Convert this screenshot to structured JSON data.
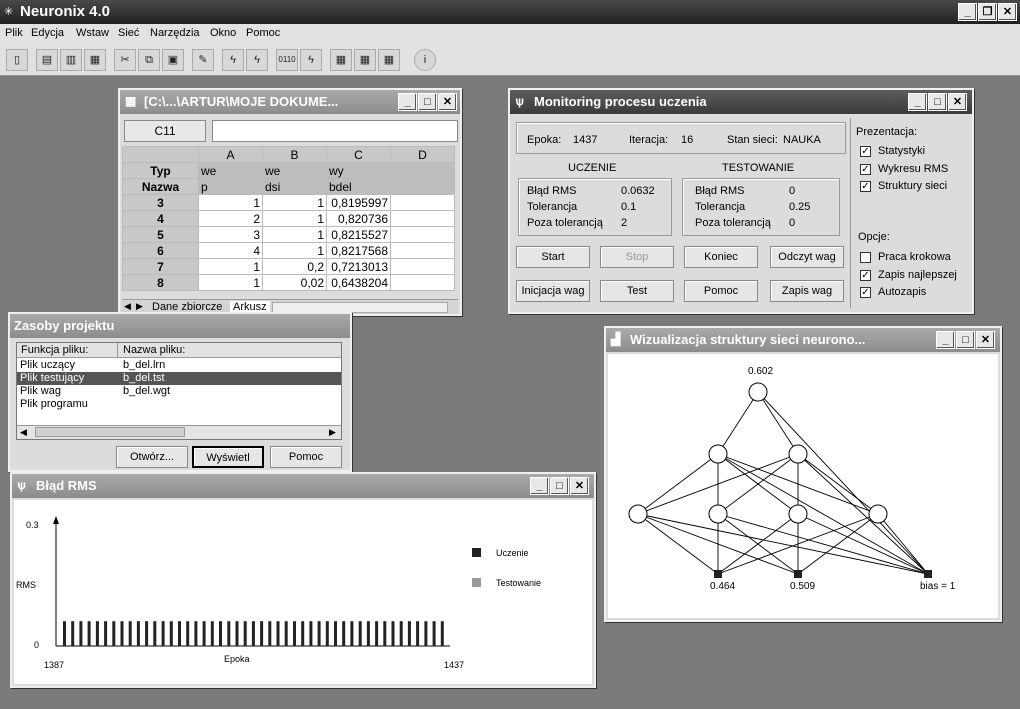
{
  "app": {
    "title": "Neuronix 4.0"
  },
  "menu": [
    "Plik",
    "Edycja",
    "Wstaw",
    "Sieć",
    "Narzędzia",
    "Okno",
    "Pomoc"
  ],
  "toolbar": {
    "icons": [
      "exit-icon",
      "new-icon",
      "open-icon",
      "save-icon",
      "cut-icon",
      "copy-icon",
      "paste-icon",
      "edit-icon",
      "learn-icon",
      "test-icon",
      "binary-icon",
      "run-icon",
      "table-icon",
      "table-export-icon",
      "table-view-icon",
      "info-icon"
    ],
    "binary_text": "0110"
  },
  "sheet": {
    "title": "[C:\\...\\ARTUR\\MOJE DOKUME...",
    "cell_ref": "C11",
    "columns": [
      "A",
      "B",
      "C",
      "D"
    ],
    "typ_label": "Typ",
    "nazwa_label": "Nazwa",
    "typ": [
      "we",
      "we",
      "wy",
      ""
    ],
    "nazwa": [
      "p",
      "dsi",
      "bdel",
      ""
    ],
    "rows": [
      {
        "n": "3",
        "a": "1",
        "b": "1",
        "c": "0,8195997"
      },
      {
        "n": "4",
        "a": "2",
        "b": "1",
        "c": "0,820736"
      },
      {
        "n": "5",
        "a": "3",
        "b": "1",
        "c": "0,8215527"
      },
      {
        "n": "6",
        "a": "4",
        "b": "1",
        "c": "0,8217568"
      },
      {
        "n": "7",
        "a": "1",
        "b": "0,2",
        "c": "0,7213013"
      },
      {
        "n": "8",
        "a": "1",
        "b": "0,02",
        "c": "0,6438204"
      }
    ],
    "tabs": [
      "Dane zbiorcze",
      "Arkusz"
    ]
  },
  "monitor": {
    "title": "Monitoring procesu uczenia",
    "epoka_label": "Epoka:",
    "epoka": "1437",
    "iteracja_label": "Iteracja:",
    "iteracja": "16",
    "stan_label": "Stan sieci:",
    "stan": "NAUKA",
    "uczenie": "UCZENIE",
    "testowanie": "TESTOWANIE",
    "rms_label": "Błąd RMS",
    "tol_label": "Tolerancja",
    "poza_label": "Poza tolerancją",
    "u_rms": "0.0632",
    "u_tol": "0.1",
    "u_poza": "2",
    "t_rms": "0",
    "t_tol": "0.25",
    "t_poza": "0",
    "buttons": {
      "start": "Start",
      "stop": "Stop",
      "koniec": "Koniec",
      "odczyt": "Odczyt wag",
      "inicjacja": "Inicjacja wag",
      "test": "Test",
      "pomoc": "Pomoc",
      "zapis": "Zapis wag"
    },
    "prezentacja": "Prezentacja:",
    "p1": "Statystyki",
    "p2": "Wykresu RMS",
    "p3": "Struktury sieci",
    "opcje": "Opcje:",
    "o1": "Praca krokowa",
    "o2": "Zapis najlepszej",
    "o3": "Autozapis",
    "checked": {
      "p1": true,
      "p2": true,
      "p3": true,
      "o1": false,
      "o2": true,
      "o3": true
    }
  },
  "zasoby": {
    "title": "Zasoby projektu",
    "col1": "Funkcja pliku:",
    "col2": "Nazwa pliku:",
    "rows": [
      [
        "Plik uczący",
        "b_del.lrn"
      ],
      [
        "Plik testujący",
        "b_del.tst"
      ],
      [
        "Plik wag",
        "b_del.wgt"
      ],
      [
        "Plik programu",
        ""
      ]
    ],
    "selected": 1,
    "btn_open": "Otwórz...",
    "btn_show": "Wyświetl",
    "btn_help": "Pomoc"
  },
  "rms": {
    "title": "Błąd RMS",
    "legend_u": "Uczenie",
    "legend_t": "Testowanie",
    "colors": {
      "uczenie": "#222222",
      "testowanie": "#999999"
    }
  },
  "chart_data": {
    "type": "bar",
    "title": "",
    "xlabel": "Epoka",
    "ylabel": "RMS",
    "xlim": [
      1387,
      1437
    ],
    "ylim": [
      0,
      0.3
    ],
    "x_ticks": [
      "1387",
      "1437"
    ],
    "y_ticks": [
      "0.3",
      "0"
    ],
    "series": [
      {
        "name": "Uczenie",
        "values": [
          0.06,
          0.06,
          0.06,
          0.06,
          0.06,
          0.06,
          0.06,
          0.06,
          0.06,
          0.06,
          0.06,
          0.06,
          0.06,
          0.06,
          0.06,
          0.06,
          0.06,
          0.06,
          0.06,
          0.06,
          0.06,
          0.06,
          0.06,
          0.06,
          0.06,
          0.06,
          0.06,
          0.06,
          0.06,
          0.06,
          0.06,
          0.06,
          0.06,
          0.06,
          0.06,
          0.06,
          0.06,
          0.06,
          0.06,
          0.06,
          0.06,
          0.06,
          0.06,
          0.06,
          0.06,
          0.06,
          0.06
        ]
      }
    ]
  },
  "network": {
    "title": "Wizualizacja struktury sieci neurono...",
    "out_value": "0.602",
    "in1_value": "0.464",
    "in2_value": "0.509",
    "bias_label": "bias = 1"
  }
}
